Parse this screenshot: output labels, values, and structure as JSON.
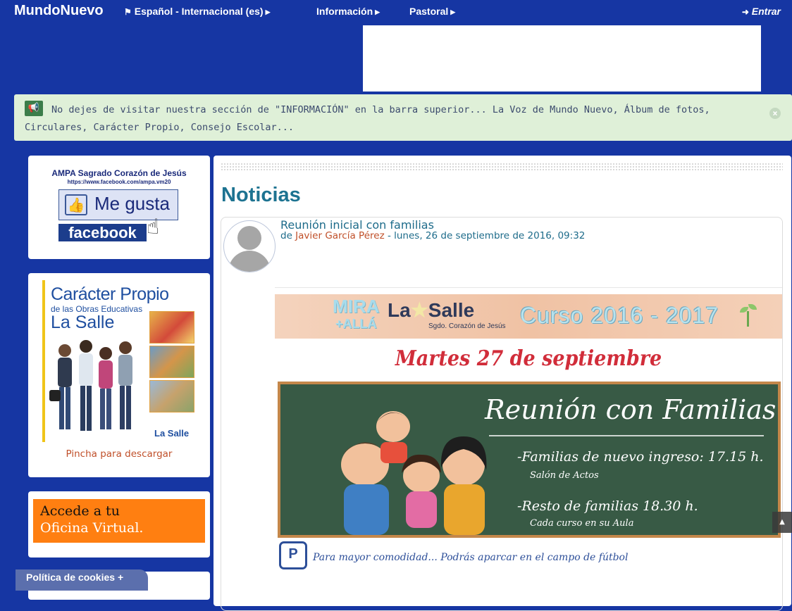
{
  "navbar": {
    "brand": "MundoNuevo",
    "language": "Español - Internacional (es)",
    "info": "Información",
    "pastoral": "Pastoral",
    "login": "Entrar"
  },
  "alert": {
    "text": "No dejes de visitar nuestra sección de \"INFORMACIÓN\" en la barra superior... La Voz de Mundo Nuevo, Álbum de fotos, Circulares, Carácter Propio, Consejo Escolar..."
  },
  "sidebar": {
    "ampa": {
      "title": "AMPA Sagrado Corazón de Jesús",
      "url": "https://www.facebook.com/ampa.vm20",
      "like": "Me gusta",
      "facebook": "facebook"
    },
    "caracter": {
      "line1": "Carácter Propio",
      "line2": "de las Obras Educativas",
      "line3": "La Salle",
      "brand": "La Salle",
      "link": "Pincha para descargar"
    },
    "oficina": {
      "line1": "Accede a tu",
      "line2": "Oficina Virtual."
    }
  },
  "main": {
    "heading": "Noticias",
    "post": {
      "title": "Reunión inicial con familias",
      "by": "de",
      "author": "Javier García Pérez",
      "date": "- lunes, 26 de septiembre de 2016, 09:32"
    },
    "poster": {
      "mira": "MIRA",
      "mas_alla": "+ALLÁ",
      "logo_la": "La",
      "logo_star": "★",
      "logo_salle": "Salle",
      "logo_sub": "Sgdo. Corazón de Jesús",
      "curso": "Curso 2016 - 2017",
      "date": "Martes 27 de septiembre",
      "board_title": "Reunión con Familias",
      "item1": "-Familias de nuevo ingreso: 17.15 h.",
      "item1_place": "Salón de Actos",
      "item2": "-Resto de familias 18.30 h.",
      "item2_place": "Cada curso en su Aula",
      "parking_icon": "P",
      "parking": "Para mayor comodidad... Podrás aparcar en el campo de fútbol"
    }
  },
  "cookie": {
    "label": "Política de cookies +"
  },
  "colors": {
    "background": "#1636a3",
    "alert_bg": "#dff0d8",
    "heading": "#1d7391",
    "link": "#c0502a",
    "oficina": "#ff7f11"
  },
  "icons": [
    "flag-icon",
    "chevron-right-icon",
    "sign-in-icon",
    "bullhorn-icon",
    "close-icon",
    "thumbs-up-icon",
    "pointer-hand-icon",
    "avatar-placeholder-icon",
    "parking-icon",
    "chevron-up-icon"
  ]
}
